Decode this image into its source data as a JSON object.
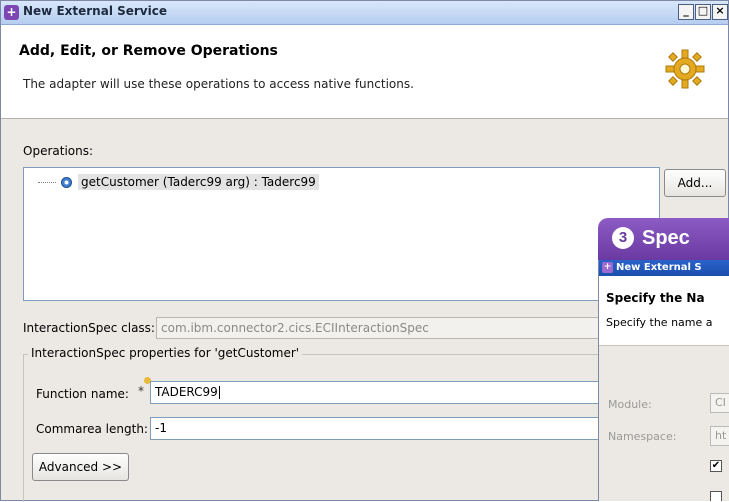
{
  "window": {
    "title": "New External Service",
    "controls": [
      "_",
      "□",
      "×"
    ]
  },
  "header": {
    "title": "Add, Edit, or Remove Operations",
    "description": "The adapter will use these operations to access native functions."
  },
  "operations": {
    "label": "Operations:",
    "items": [
      {
        "label": "getCustomer (Taderc99 arg) : Taderc99"
      }
    ],
    "add_button": "Add..."
  },
  "interaction_spec": {
    "class_label": "InteractionSpec class:",
    "class_value": "com.ibm.connector2.cics.ECIInteractionSpec",
    "group_title": "InteractionSpec properties for 'getCustomer'",
    "function_name_label": "Function name:",
    "required_marker": "*",
    "function_name_value": "TADERC99",
    "commarea_label": "Commarea length:",
    "commarea_value": "-1",
    "advanced_button": "Advanced >>"
  },
  "overlay": {
    "step_number": "3",
    "step_text": "Spec",
    "window_title": "New External S",
    "header_title": "Specify the Na",
    "header_desc": "Specify the name a",
    "module_label": "Module:",
    "module_value": "CI",
    "namespace_label": "Namespace:",
    "namespace_value": "ht",
    "checkbox_mark": "✔"
  },
  "colors": {
    "accent_purple": "#6a3aa2",
    "titlebar_blue": "#b6cdf0",
    "dialog_bg": "#ece9e4"
  }
}
